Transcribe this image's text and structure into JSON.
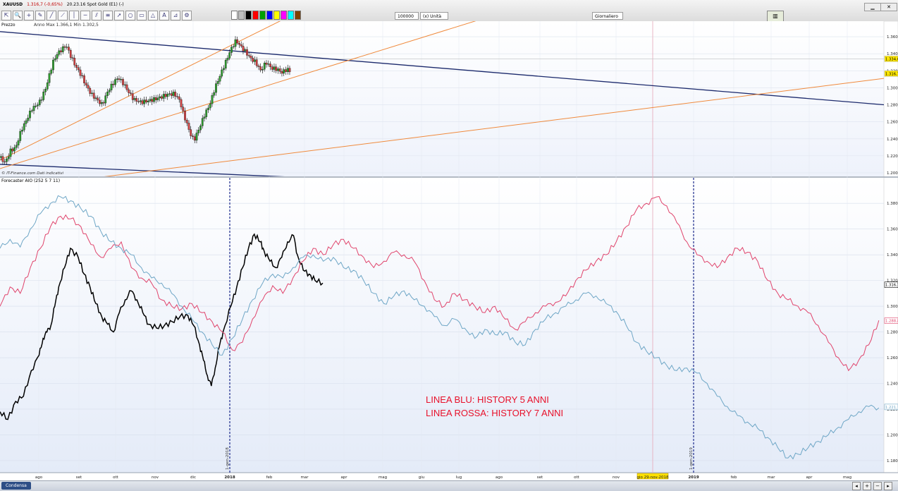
{
  "toolbar": {
    "symbol": "XAUUSD",
    "price_change": "1.316,7 (-0,65%)",
    "time_name": "20.23.16 Spot Gold (E1) (-)",
    "quantity_value": "100000",
    "unit_select": "(x) Unità",
    "period_select": "Giornaliero",
    "window_buttons": [
      "▁",
      "▢",
      "✕"
    ],
    "icons": [
      "cursor-icon",
      "magnifier-icon",
      "crosshair-icon",
      "pencil-icon",
      "line-icon",
      "trendline-icon",
      "vertical-line-icon",
      "horizontal-line-icon",
      "channel-icon",
      "fibonacci-icon",
      "arrow-icon",
      "circle-icon",
      "rectangle-icon",
      "triangle-icon",
      "text-icon",
      "fan-icon",
      "settings-icon"
    ],
    "icon_glyphs": [
      "⇱",
      "🔍",
      "+",
      "✎",
      "╱",
      "⟋",
      "│",
      "─",
      "⫽",
      "≡",
      "➚",
      "○",
      "▭",
      "△",
      "A",
      "⊿",
      "⚙"
    ],
    "swatch_colors": [
      "#ffffff",
      "#c0c0c0",
      "#000000",
      "#ff0000",
      "#00a000",
      "#0000ff",
      "#ffff00",
      "#ff00ff",
      "#00ffff",
      "#804000"
    ]
  },
  "chart_data": [
    {
      "type": "candlestick",
      "title": "Prezzo",
      "annotation": "Anno Max 1.366,1 Min 1.302,5",
      "footer_note": "© IT-Finance.com Dati indicativi",
      "y_ticks": [
        "1.360",
        "1.340",
        "1.320",
        "1.300",
        "1.280",
        "1.260",
        "1.240",
        "1.220",
        "1.200"
      ],
      "ylim": [
        1200,
        1370
      ],
      "current_price_labels": [
        "1.334,0",
        "1.316,7"
      ],
      "close_series": [
        [
          0,
          1218
        ],
        [
          6,
          1212
        ],
        [
          12,
          1226
        ],
        [
          18,
          1230
        ],
        [
          24,
          1250
        ],
        [
          30,
          1262
        ],
        [
          36,
          1275
        ],
        [
          42,
          1280
        ],
        [
          46,
          1285
        ],
        [
          52,
          1300
        ],
        [
          56,
          1315
        ],
        [
          60,
          1330
        ],
        [
          65,
          1340
        ],
        [
          70,
          1345
        ],
        [
          75,
          1350
        ],
        [
          80,
          1338
        ],
        [
          86,
          1325
        ],
        [
          92,
          1315
        ],
        [
          98,
          1302
        ],
        [
          104,
          1292
        ],
        [
          110,
          1286
        ],
        [
          116,
          1280
        ],
        [
          122,
          1295
        ],
        [
          128,
          1305
        ],
        [
          134,
          1312
        ],
        [
          140,
          1305
        ],
        [
          146,
          1295
        ],
        [
          152,
          1286
        ],
        [
          160,
          1283
        ],
        [
          170,
          1285
        ],
        [
          180,
          1288
        ],
        [
          190,
          1292
        ],
        [
          198,
          1293
        ],
        [
          204,
          1285
        ],
        [
          208,
          1270
        ],
        [
          212,
          1258
        ],
        [
          216,
          1246
        ],
        [
          220,
          1238
        ],
        [
          226,
          1252
        ],
        [
          232,
          1268
        ],
        [
          238,
          1280
        ],
        [
          244,
          1300
        ],
        [
          250,
          1315
        ],
        [
          256,
          1330
        ],
        [
          262,
          1345
        ],
        [
          268,
          1356
        ],
        [
          272,
          1350
        ],
        [
          278,
          1343
        ],
        [
          284,
          1335
        ],
        [
          290,
          1330
        ],
        [
          296,
          1320
        ],
        [
          302,
          1330
        ],
        [
          308,
          1323
        ],
        [
          314,
          1322
        ],
        [
          320,
          1318
        ],
        [
          326,
          1322
        ],
        [
          330,
          1318
        ]
      ],
      "trendlines": [
        {
          "name": "blue-downtrend-upper",
          "color": "#1c2a6c",
          "points": [
            [
              0,
              1366
            ],
            [
              456,
              1280
            ]
          ]
        },
        {
          "name": "blue-downtrend-lower",
          "color": "#1c2a6c",
          "points": [
            [
              0,
              1210
            ],
            [
              200,
              1190
            ]
          ]
        },
        {
          "name": "orange-fan-steep",
          "color": "#f08a3c",
          "points": [
            [
              0,
              1215
            ],
            [
              160,
              1396
            ]
          ]
        },
        {
          "name": "orange-fan-medium",
          "color": "#f08a3c",
          "points": [
            [
              0,
              1205
            ],
            [
              270,
              1396
            ]
          ]
        },
        {
          "name": "orange-fan-shallow",
          "color": "#f08a3c",
          "points": [
            [
              0,
              1180
            ],
            [
              456,
              1311
            ]
          ]
        }
      ],
      "horizontal_level": 1334
    },
    {
      "type": "line",
      "title": "Forecaster AIO (252 5 7 11)",
      "x_ticks": [
        "ago",
        "set",
        "ott",
        "nov",
        "dic",
        "2018",
        "feb",
        "mar",
        "apr",
        "mag",
        "giu",
        "lug",
        "ago",
        "set",
        "ott",
        "nov",
        "gio 29-nov-2018",
        "2019",
        "feb",
        "mar",
        "apr",
        "mag"
      ],
      "y_ticks": [
        "1.380",
        "1.360",
        "1.340",
        "1.320",
        "1.300",
        "1.280",
        "1.260",
        "1.240",
        "1.220",
        "1.200",
        "1.180"
      ],
      "ylim": [
        1175,
        1390
      ],
      "right_labels": [
        "1.316,7",
        "1.288,8",
        "1.221,7"
      ],
      "vline_labels": [
        "1-gen-2018",
        "1-gen-2019"
      ],
      "annotations": [
        "LINEA BLU: HISTORY 5 ANNI",
        "LINEA ROSSA: HISTORY 7 ANNI"
      ],
      "series": [
        {
          "color": "#000000",
          "x": [
            0,
            8,
            16,
            24,
            32,
            40,
            44,
            48,
            52,
            56,
            60,
            66,
            72,
            80,
            86,
            92,
            98,
            104,
            110,
            116,
            122,
            128,
            134,
            140,
            146,
            152,
            160,
            168,
            176,
            184,
            192,
            198,
            204,
            208,
            212,
            216,
            220,
            224,
            228,
            236,
            242,
            248,
            254,
            260,
            266,
            270,
            276,
            282,
            288,
            294,
            300,
            304,
            310,
            316,
            322,
            330
          ],
          "values": [
            1218,
            1212,
            1226,
            1230,
            1250,
            1262,
            1275,
            1280,
            1285,
            1300,
            1315,
            1330,
            1345,
            1338,
            1325,
            1315,
            1302,
            1292,
            1286,
            1280,
            1295,
            1305,
            1312,
            1305,
            1295,
            1286,
            1283,
            1285,
            1288,
            1292,
            1293,
            1285,
            1270,
            1258,
            1246,
            1238,
            1252,
            1268,
            1280,
            1300,
            1315,
            1330,
            1345,
            1356,
            1350,
            1343,
            1335,
            1330,
            1338,
            1350,
            1355,
            1340,
            1328,
            1325,
            1320,
            1318
          ]
        },
        {
          "color": "#e0446c",
          "x": [
            0,
            8,
            16,
            24,
            32,
            40,
            48,
            56,
            64,
            72,
            80,
            88,
            96,
            104,
            112,
            120,
            128,
            136,
            144,
            152,
            160,
            168,
            176,
            184,
            192,
            200,
            208,
            216,
            224,
            232,
            240,
            248,
            256,
            264,
            272,
            280,
            288,
            296,
            304,
            312,
            320,
            328,
            336,
            344,
            352,
            360,
            368,
            376,
            384,
            392,
            400,
            408,
            416,
            424,
            432,
            440,
            448,
            456,
            464,
            472,
            480,
            488,
            496,
            504,
            512,
            520,
            528,
            536,
            544,
            552,
            560,
            568,
            576,
            584,
            592,
            600,
            608,
            616,
            624,
            632,
            640,
            648,
            656,
            664,
            672,
            680,
            688,
            696
          ],
          "values": [
            1300,
            1315,
            1310,
            1330,
            1345,
            1362,
            1370,
            1368,
            1362,
            1348,
            1338,
            1345,
            1350,
            1330,
            1322,
            1318,
            1305,
            1300,
            1298,
            1302,
            1295,
            1288,
            1280,
            1266,
            1272,
            1290,
            1305,
            1316,
            1310,
            1322,
            1335,
            1345,
            1340,
            1348,
            1352,
            1345,
            1338,
            1330,
            1335,
            1342,
            1340,
            1335,
            1320,
            1305,
            1300,
            1310,
            1305,
            1300,
            1295,
            1300,
            1290,
            1282,
            1288,
            1295,
            1300,
            1303,
            1308,
            1320,
            1328,
            1335,
            1340,
            1350,
            1362,
            1375,
            1380,
            1385,
            1378,
            1365,
            1350,
            1340,
            1335,
            1330,
            1338,
            1345,
            1342,
            1335,
            1320,
            1310,
            1305,
            1300,
            1295,
            1285,
            1272,
            1260,
            1250,
            1258,
            1270,
            1289
          ]
        },
        {
          "color": "#6ea6c6",
          "x": [
            0,
            8,
            16,
            24,
            32,
            40,
            48,
            56,
            64,
            72,
            80,
            88,
            96,
            104,
            112,
            120,
            128,
            136,
            144,
            152,
            160,
            168,
            176,
            184,
            192,
            200,
            208,
            216,
            224,
            232,
            240,
            248,
            256,
            264,
            272,
            280,
            288,
            296,
            304,
            312,
            320,
            328,
            336,
            344,
            352,
            360,
            368,
            376,
            384,
            392,
            400,
            408,
            416,
            424,
            432,
            440,
            448,
            456,
            464,
            472,
            480,
            488,
            496,
            504,
            512,
            520,
            528,
            536,
            544,
            552,
            560,
            568,
            576,
            584,
            592,
            600,
            608,
            616,
            624,
            632,
            640,
            648,
            656,
            664,
            672,
            680,
            688,
            696
          ],
          "values": [
            1345,
            1352,
            1346,
            1360,
            1372,
            1380,
            1385,
            1382,
            1376,
            1370,
            1358,
            1350,
            1345,
            1340,
            1330,
            1322,
            1318,
            1310,
            1300,
            1290,
            1280,
            1270,
            1262,
            1275,
            1290,
            1305,
            1318,
            1325,
            1322,
            1330,
            1338,
            1340,
            1335,
            1338,
            1330,
            1328,
            1320,
            1310,
            1302,
            1308,
            1312,
            1305,
            1300,
            1292,
            1285,
            1290,
            1283,
            1275,
            1282,
            1278,
            1280,
            1272,
            1270,
            1282,
            1290,
            1295,
            1300,
            1305,
            1310,
            1308,
            1302,
            1296,
            1285,
            1272,
            1265,
            1260,
            1254,
            1250,
            1252,
            1248,
            1240,
            1230,
            1222,
            1215,
            1210,
            1205,
            1198,
            1190,
            1182,
            1185,
            1190,
            1195,
            1200,
            1206,
            1212,
            1218,
            1222,
            1221
          ]
        }
      ]
    }
  ],
  "statusbar": {
    "button_label": "Condensa"
  }
}
